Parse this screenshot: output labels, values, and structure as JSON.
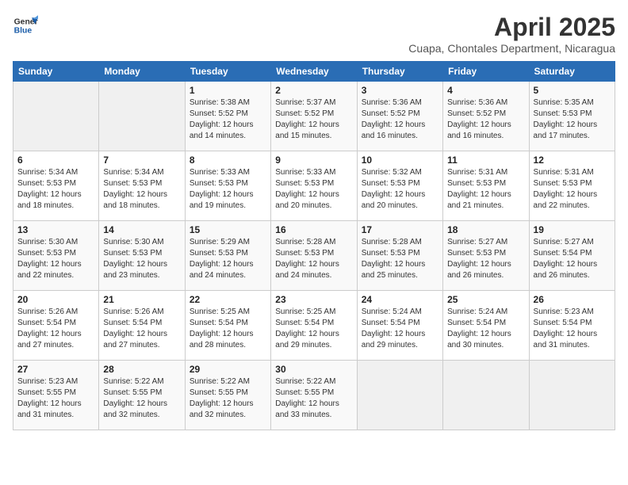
{
  "header": {
    "logo_line1": "General",
    "logo_line2": "Blue",
    "month": "April 2025",
    "location": "Cuapa, Chontales Department, Nicaragua"
  },
  "weekdays": [
    "Sunday",
    "Monday",
    "Tuesday",
    "Wednesday",
    "Thursday",
    "Friday",
    "Saturday"
  ],
  "weeks": [
    [
      {
        "day": "",
        "sunrise": "",
        "sunset": "",
        "daylight": ""
      },
      {
        "day": "",
        "sunrise": "",
        "sunset": "",
        "daylight": ""
      },
      {
        "day": "1",
        "sunrise": "Sunrise: 5:38 AM",
        "sunset": "Sunset: 5:52 PM",
        "daylight": "Daylight: 12 hours and 14 minutes."
      },
      {
        "day": "2",
        "sunrise": "Sunrise: 5:37 AM",
        "sunset": "Sunset: 5:52 PM",
        "daylight": "Daylight: 12 hours and 15 minutes."
      },
      {
        "day": "3",
        "sunrise": "Sunrise: 5:36 AM",
        "sunset": "Sunset: 5:52 PM",
        "daylight": "Daylight: 12 hours and 16 minutes."
      },
      {
        "day": "4",
        "sunrise": "Sunrise: 5:36 AM",
        "sunset": "Sunset: 5:52 PM",
        "daylight": "Daylight: 12 hours and 16 minutes."
      },
      {
        "day": "5",
        "sunrise": "Sunrise: 5:35 AM",
        "sunset": "Sunset: 5:53 PM",
        "daylight": "Daylight: 12 hours and 17 minutes."
      }
    ],
    [
      {
        "day": "6",
        "sunrise": "Sunrise: 5:34 AM",
        "sunset": "Sunset: 5:53 PM",
        "daylight": "Daylight: 12 hours and 18 minutes."
      },
      {
        "day": "7",
        "sunrise": "Sunrise: 5:34 AM",
        "sunset": "Sunset: 5:53 PM",
        "daylight": "Daylight: 12 hours and 18 minutes."
      },
      {
        "day": "8",
        "sunrise": "Sunrise: 5:33 AM",
        "sunset": "Sunset: 5:53 PM",
        "daylight": "Daylight: 12 hours and 19 minutes."
      },
      {
        "day": "9",
        "sunrise": "Sunrise: 5:33 AM",
        "sunset": "Sunset: 5:53 PM",
        "daylight": "Daylight: 12 hours and 20 minutes."
      },
      {
        "day": "10",
        "sunrise": "Sunrise: 5:32 AM",
        "sunset": "Sunset: 5:53 PM",
        "daylight": "Daylight: 12 hours and 20 minutes."
      },
      {
        "day": "11",
        "sunrise": "Sunrise: 5:31 AM",
        "sunset": "Sunset: 5:53 PM",
        "daylight": "Daylight: 12 hours and 21 minutes."
      },
      {
        "day": "12",
        "sunrise": "Sunrise: 5:31 AM",
        "sunset": "Sunset: 5:53 PM",
        "daylight": "Daylight: 12 hours and 22 minutes."
      }
    ],
    [
      {
        "day": "13",
        "sunrise": "Sunrise: 5:30 AM",
        "sunset": "Sunset: 5:53 PM",
        "daylight": "Daylight: 12 hours and 22 minutes."
      },
      {
        "day": "14",
        "sunrise": "Sunrise: 5:30 AM",
        "sunset": "Sunset: 5:53 PM",
        "daylight": "Daylight: 12 hours and 23 minutes."
      },
      {
        "day": "15",
        "sunrise": "Sunrise: 5:29 AM",
        "sunset": "Sunset: 5:53 PM",
        "daylight": "Daylight: 12 hours and 24 minutes."
      },
      {
        "day": "16",
        "sunrise": "Sunrise: 5:28 AM",
        "sunset": "Sunset: 5:53 PM",
        "daylight": "Daylight: 12 hours and 24 minutes."
      },
      {
        "day": "17",
        "sunrise": "Sunrise: 5:28 AM",
        "sunset": "Sunset: 5:53 PM",
        "daylight": "Daylight: 12 hours and 25 minutes."
      },
      {
        "day": "18",
        "sunrise": "Sunrise: 5:27 AM",
        "sunset": "Sunset: 5:53 PM",
        "daylight": "Daylight: 12 hours and 26 minutes."
      },
      {
        "day": "19",
        "sunrise": "Sunrise: 5:27 AM",
        "sunset": "Sunset: 5:54 PM",
        "daylight": "Daylight: 12 hours and 26 minutes."
      }
    ],
    [
      {
        "day": "20",
        "sunrise": "Sunrise: 5:26 AM",
        "sunset": "Sunset: 5:54 PM",
        "daylight": "Daylight: 12 hours and 27 minutes."
      },
      {
        "day": "21",
        "sunrise": "Sunrise: 5:26 AM",
        "sunset": "Sunset: 5:54 PM",
        "daylight": "Daylight: 12 hours and 27 minutes."
      },
      {
        "day": "22",
        "sunrise": "Sunrise: 5:25 AM",
        "sunset": "Sunset: 5:54 PM",
        "daylight": "Daylight: 12 hours and 28 minutes."
      },
      {
        "day": "23",
        "sunrise": "Sunrise: 5:25 AM",
        "sunset": "Sunset: 5:54 PM",
        "daylight": "Daylight: 12 hours and 29 minutes."
      },
      {
        "day": "24",
        "sunrise": "Sunrise: 5:24 AM",
        "sunset": "Sunset: 5:54 PM",
        "daylight": "Daylight: 12 hours and 29 minutes."
      },
      {
        "day": "25",
        "sunrise": "Sunrise: 5:24 AM",
        "sunset": "Sunset: 5:54 PM",
        "daylight": "Daylight: 12 hours and 30 minutes."
      },
      {
        "day": "26",
        "sunrise": "Sunrise: 5:23 AM",
        "sunset": "Sunset: 5:54 PM",
        "daylight": "Daylight: 12 hours and 31 minutes."
      }
    ],
    [
      {
        "day": "27",
        "sunrise": "Sunrise: 5:23 AM",
        "sunset": "Sunset: 5:55 PM",
        "daylight": "Daylight: 12 hours and 31 minutes."
      },
      {
        "day": "28",
        "sunrise": "Sunrise: 5:22 AM",
        "sunset": "Sunset: 5:55 PM",
        "daylight": "Daylight: 12 hours and 32 minutes."
      },
      {
        "day": "29",
        "sunrise": "Sunrise: 5:22 AM",
        "sunset": "Sunset: 5:55 PM",
        "daylight": "Daylight: 12 hours and 32 minutes."
      },
      {
        "day": "30",
        "sunrise": "Sunrise: 5:22 AM",
        "sunset": "Sunset: 5:55 PM",
        "daylight": "Daylight: 12 hours and 33 minutes."
      },
      {
        "day": "",
        "sunrise": "",
        "sunset": "",
        "daylight": ""
      },
      {
        "day": "",
        "sunrise": "",
        "sunset": "",
        "daylight": ""
      },
      {
        "day": "",
        "sunrise": "",
        "sunset": "",
        "daylight": ""
      }
    ]
  ]
}
